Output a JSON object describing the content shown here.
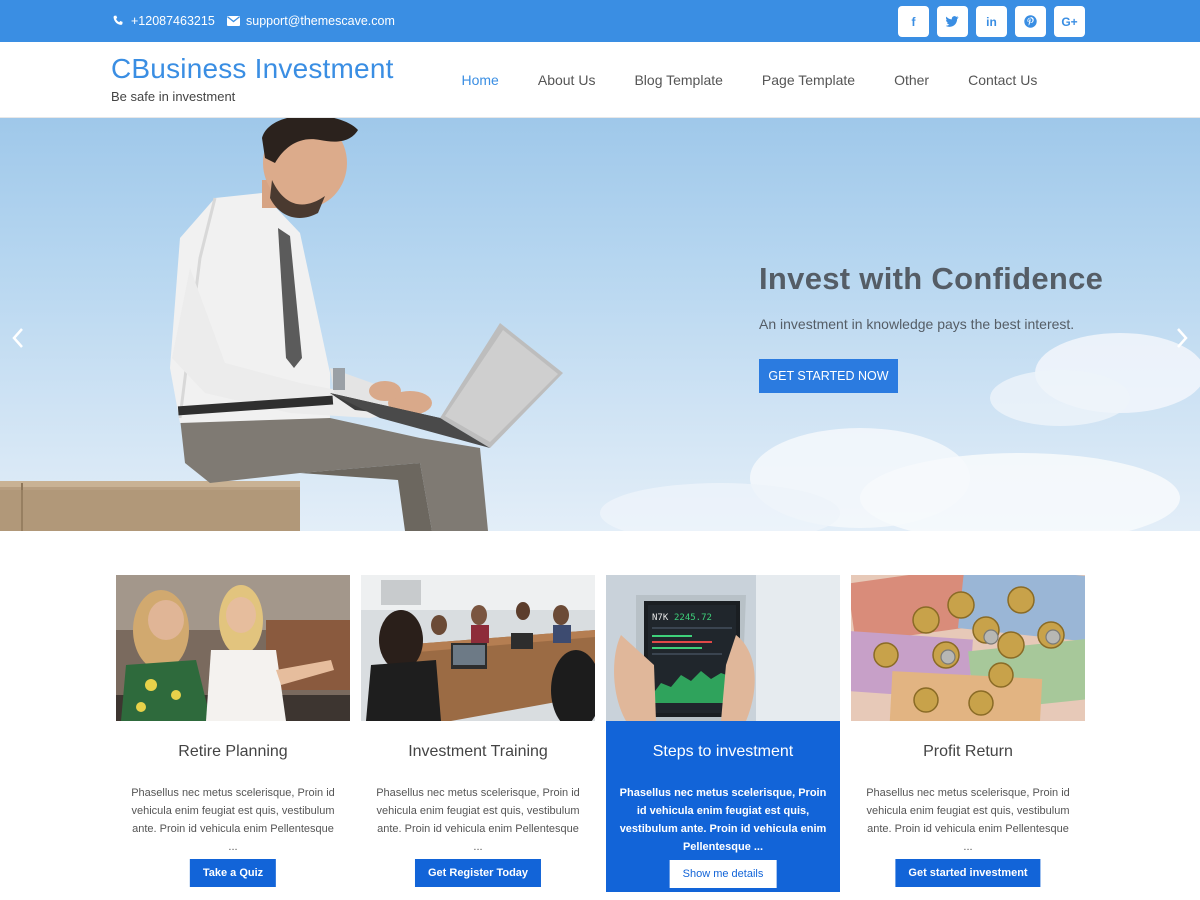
{
  "topbar": {
    "phone": "+12087463215",
    "email": "support@themescave.com",
    "phone_icon": "phone-icon",
    "email_icon": "envelope-icon",
    "socials": [
      {
        "name": "facebook-icon",
        "glyph": "f"
      },
      {
        "name": "twitter-icon",
        "glyph": "t"
      },
      {
        "name": "linkedin-icon",
        "glyph": "in"
      },
      {
        "name": "pinterest-icon",
        "glyph": "P"
      },
      {
        "name": "google-plus-icon",
        "glyph": "G+"
      }
    ]
  },
  "header": {
    "site_title": "CBusiness Investment",
    "tagline": "Be safe in investment",
    "nav": [
      "Home",
      "About Us",
      "Blog Template",
      "Page Template",
      "Other",
      "Contact Us"
    ],
    "active_nav": "Home"
  },
  "hero": {
    "title": "Invest with Confidence",
    "subtitle": "An investment in knowledge pays the best interest.",
    "button": "GET STARTED NOW"
  },
  "cards": [
    {
      "title": "Retire Planning",
      "text": "Phasellus nec metus scelerisque, Proin id vehicula enim feugiat est quis, vestibulum ante. Proin id vehicula enim Pellentesque ...",
      "button": "Take a Quiz"
    },
    {
      "title": "Investment Training",
      "text": "Phasellus nec metus scelerisque, Proin id vehicula enim feugiat est quis, vestibulum ante. Proin id vehicula enim Pellentesque ...",
      "button": "Get Register Today"
    },
    {
      "title": "Steps to investment",
      "text": "Phasellus nec metus scelerisque, Proin id vehicula enim feugiat est quis, vestibulum ante. Proin id vehicula enim Pellentesque ...",
      "button": "Show me details"
    },
    {
      "title": "Profit Return",
      "text": "Phasellus nec metus scelerisque, Proin id vehicula enim feugiat est quis, vestibulum ante. Proin id vehicula enim Pellentesque ...",
      "button": "Get started investment"
    }
  ],
  "card_images": {
    "tablet_ticker": "N7K",
    "tablet_price": "2245.72"
  },
  "colors": {
    "accent": "#3a8ee3",
    "button_blue": "#2b7be0",
    "card_featured": "#1264d8"
  }
}
